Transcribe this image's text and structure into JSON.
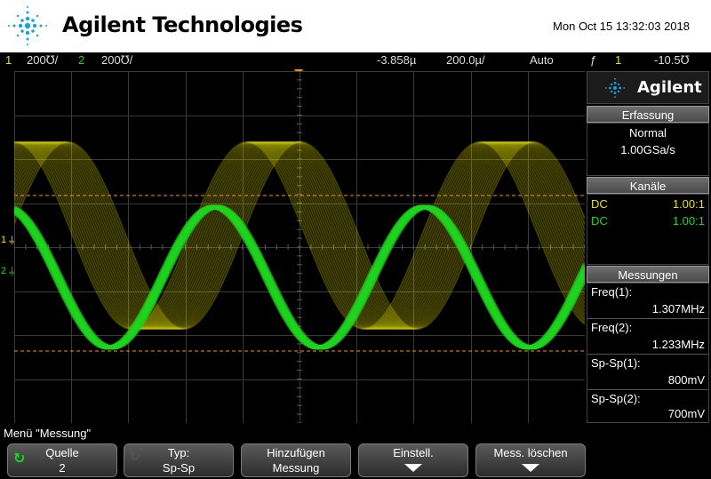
{
  "header": {
    "brand": "Agilent Technologies",
    "datetime": "Mon Oct 15 13:32:03 2018"
  },
  "status": {
    "ch1_num": "1",
    "ch1_scale": "200℧/",
    "ch2_num": "2",
    "ch2_scale": "200℧/",
    "delay": "-3.858µ",
    "timebase": "200.0µ/",
    "trigger_mode": "Auto",
    "trigger_icon": "ƒ",
    "trigger_source": "1",
    "trigger_level": "-10.5℧"
  },
  "markers": {
    "ch1_label": "1",
    "ch2_label": "2"
  },
  "panel": {
    "logo_text": "Agilent",
    "acquisition": {
      "title": "Erfassung",
      "mode": "Normal",
      "rate": "1.00GSa/s"
    },
    "channels": {
      "title": "Kanäle",
      "rows": [
        {
          "coupling": "DC",
          "probe": "1.00:1",
          "color": "#e8e600"
        },
        {
          "coupling": "DC",
          "probe": "1.00:1",
          "color": "#1fd51f"
        }
      ]
    },
    "measurements": {
      "title": "Messungen",
      "items": [
        {
          "label": "Freq(1):",
          "value": "1.307MHz"
        },
        {
          "label": "Freq(2):",
          "value": "1.233MHz"
        },
        {
          "label": "Sp-Sp(1):",
          "value": "800mV"
        },
        {
          "label": "Sp-Sp(2):",
          "value": "700mV"
        }
      ]
    }
  },
  "menu": {
    "title": "Menü \"Messung\"",
    "softkeys": [
      {
        "line1": "Quelle",
        "line2": "2"
      },
      {
        "line1": "Typ:",
        "line2": "Sp-Sp"
      },
      {
        "line1": "Hinzufügen",
        "line2": "Messung"
      },
      {
        "line1": "Einstell.",
        "line2": ""
      },
      {
        "line1": "Mess. löschen",
        "line2": ""
      }
    ]
  },
  "colors": {
    "ch1": "#e8e600",
    "ch2": "#1fd51f",
    "cursor": "#ff8c1a"
  }
}
